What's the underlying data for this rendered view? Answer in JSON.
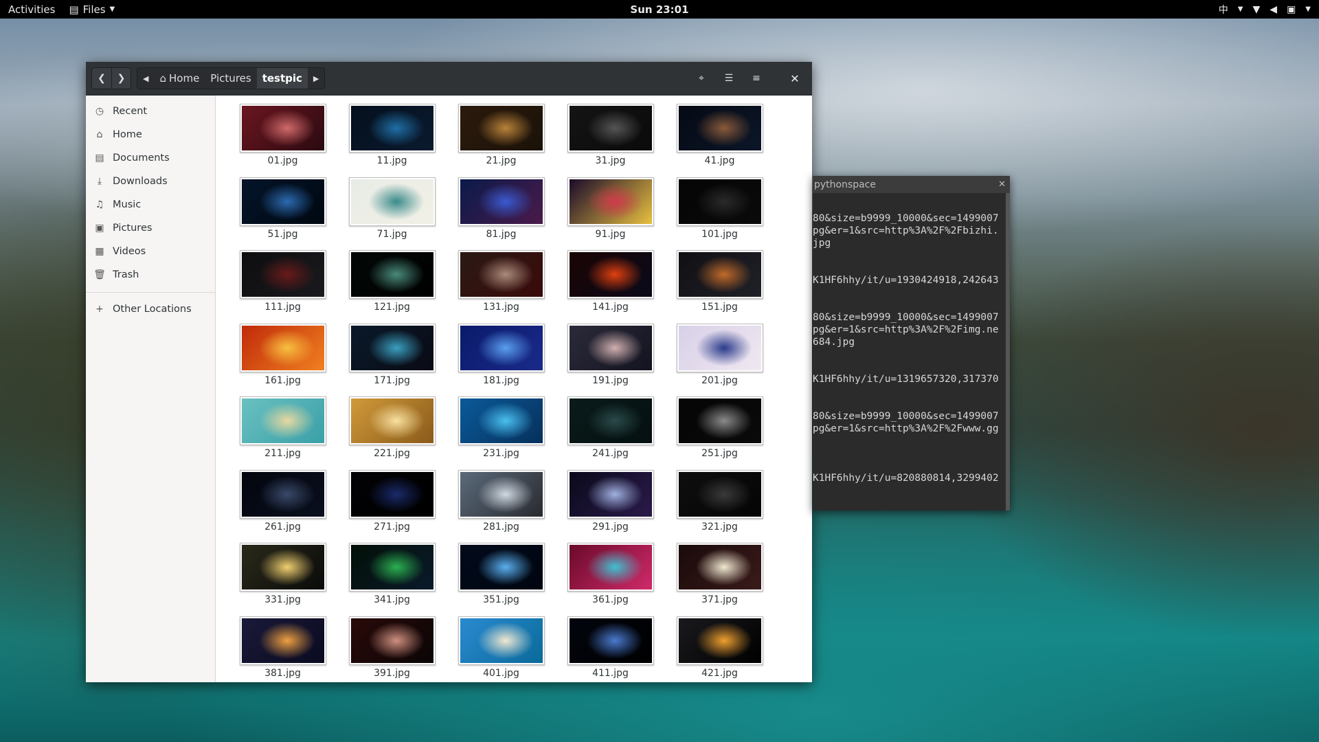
{
  "topbar": {
    "activities": "Activities",
    "app_name": "Files",
    "clock": "Sun 23:01",
    "input_method": "中"
  },
  "files": {
    "path": [
      "Home",
      "Pictures",
      "testpic"
    ],
    "sidebar": [
      {
        "label": "Recent",
        "icon": "clock-icon",
        "glyph": "◷"
      },
      {
        "label": "Home",
        "icon": "home-icon",
        "glyph": "⌂"
      },
      {
        "label": "Documents",
        "icon": "document-icon",
        "glyph": "▤"
      },
      {
        "label": "Downloads",
        "icon": "download-icon",
        "glyph": "⤓"
      },
      {
        "label": "Music",
        "icon": "music-icon",
        "glyph": "♫"
      },
      {
        "label": "Pictures",
        "icon": "picture-icon",
        "glyph": "▣"
      },
      {
        "label": "Videos",
        "icon": "video-icon",
        "glyph": "▦"
      },
      {
        "label": "Trash",
        "icon": "trash-icon",
        "glyph": "🗑"
      }
    ],
    "other_locations": "Other Locations",
    "items": [
      {
        "name": "01.jpg",
        "colors": [
          "#6b1620",
          "#d06a6a",
          "#2a0a10"
        ]
      },
      {
        "name": "11.jpg",
        "colors": [
          "#05101e",
          "#1f6fa6",
          "#0a1a2e"
        ]
      },
      {
        "name": "21.jpg",
        "colors": [
          "#2c1a0c",
          "#b9833a",
          "#1a1208"
        ]
      },
      {
        "name": "31.jpg",
        "colors": [
          "#141414",
          "#555555",
          "#0a0a0a"
        ]
      },
      {
        "name": "41.jpg",
        "colors": [
          "#050a14",
          "#8a5a3a",
          "#0c1628"
        ]
      },
      {
        "name": "51.jpg",
        "colors": [
          "#04142a",
          "#2c6ab0",
          "#000810"
        ]
      },
      {
        "name": "71.jpg",
        "colors": [
          "#e8ece6",
          "#3a8a8a",
          "#f2f0e6"
        ]
      },
      {
        "name": "81.jpg",
        "colors": [
          "#0a1a4a",
          "#3a5ad0",
          "#4a1a4a"
        ]
      },
      {
        "name": "91.jpg",
        "colors": [
          "#1a0a2a",
          "#d03a4a",
          "#e8c040"
        ]
      },
      {
        "name": "101.jpg",
        "colors": [
          "#050505",
          "#2a2a2a",
          "#0a0a0a"
        ]
      },
      {
        "name": "111.jpg",
        "colors": [
          "#0e0e10",
          "#6a1a1a",
          "#1a1a1e"
        ]
      },
      {
        "name": "121.jpg",
        "colors": [
          "#020806",
          "#4a8a7a",
          "#000000"
        ]
      },
      {
        "name": "131.jpg",
        "colors": [
          "#2a1a14",
          "#aa8a7a",
          "#3a0a0a"
        ]
      },
      {
        "name": "141.jpg",
        "colors": [
          "#1a0404",
          "#e04010",
          "#0a0a1a"
        ]
      },
      {
        "name": "151.jpg",
        "colors": [
          "#101014",
          "#c06a2a",
          "#202028"
        ]
      },
      {
        "name": "161.jpg",
        "colors": [
          "#c02a0a",
          "#f8c040",
          "#f08020"
        ]
      },
      {
        "name": "171.jpg",
        "colors": [
          "#0a1a2a",
          "#3aa0c0",
          "#0a0a14"
        ]
      },
      {
        "name": "181.jpg",
        "colors": [
          "#0a1a6a",
          "#5aa0f0",
          "#1a2a8a"
        ]
      },
      {
        "name": "191.jpg",
        "colors": [
          "#2a2a3a",
          "#d0b0b0",
          "#141420"
        ]
      },
      {
        "name": "201.jpg",
        "colors": [
          "#d8d0e8",
          "#2a3a8a",
          "#f0e8f0"
        ]
      },
      {
        "name": "211.jpg",
        "colors": [
          "#6ac0c0",
          "#e8d8a0",
          "#3aa0a8"
        ]
      },
      {
        "name": "221.jpg",
        "colors": [
          "#d09a3a",
          "#f8e0a0",
          "#8a5a1a"
        ]
      },
      {
        "name": "231.jpg",
        "colors": [
          "#0a5a9a",
          "#4ac0f0",
          "#06305a"
        ]
      },
      {
        "name": "241.jpg",
        "colors": [
          "#0a1a1a",
          "#2a4a4a",
          "#051010"
        ]
      },
      {
        "name": "251.jpg",
        "colors": [
          "#050505",
          "#8a8a8a",
          "#0a0a0a"
        ]
      },
      {
        "name": "261.jpg",
        "colors": [
          "#03060e",
          "#3a4a6a",
          "#0a0f1e"
        ]
      },
      {
        "name": "271.jpg",
        "colors": [
          "#020205",
          "#1a2a6a",
          "#000000"
        ]
      },
      {
        "name": "281.jpg",
        "colors": [
          "#5a6a7a",
          "#d0d8e0",
          "#2a2a30"
        ]
      },
      {
        "name": "291.jpg",
        "colors": [
          "#0a0a1a",
          "#a0b0e0",
          "#2a1a4a"
        ]
      },
      {
        "name": "321.jpg",
        "colors": [
          "#0e0e0e",
          "#3a3a3a",
          "#050505"
        ]
      },
      {
        "name": "331.jpg",
        "colors": [
          "#2a2a1a",
          "#f0d070",
          "#0a0a0a"
        ]
      },
      {
        "name": "341.jpg",
        "colors": [
          "#031008",
          "#2ab050",
          "#0a1a2a"
        ]
      },
      {
        "name": "351.jpg",
        "colors": [
          "#020a1a",
          "#5ab0f0",
          "#000510"
        ]
      },
      {
        "name": "361.jpg",
        "colors": [
          "#6a0a2a",
          "#40c0d0",
          "#d02a6a"
        ]
      },
      {
        "name": "371.jpg",
        "colors": [
          "#1a0a0a",
          "#f0e8d0",
          "#3a1a1a"
        ]
      },
      {
        "name": "381.jpg",
        "colors": [
          "#1a1a3a",
          "#f0a040",
          "#0a0a20"
        ]
      },
      {
        "name": "391.jpg",
        "colors": [
          "#2a0a0a",
          "#d09080",
          "#0a0505"
        ]
      },
      {
        "name": "401.jpg",
        "colors": [
          "#2a8ad0",
          "#f0e8d0",
          "#0a6a9a"
        ]
      },
      {
        "name": "411.jpg",
        "colors": [
          "#02050e",
          "#4a7ad0",
          "#000000"
        ]
      },
      {
        "name": "421.jpg",
        "colors": [
          "#1a1a1e",
          "#f0a030",
          "#000000"
        ]
      }
    ]
  },
  "terminal": {
    "title": "pythonspace",
    "lines": [
      "80&size=b9999_10000&sec=1499007",
      "pg&er=1&src=http%3A%2F%2Fbizhi.",
      "jpg",
      "",
      "",
      "K1HF6hhy/it/u=1930424918,242643",
      "",
      "",
      "80&size=b9999_10000&sec=1499007",
      "pg&er=1&src=http%3A%2F%2Fimg.ne",
      "684.jpg",
      "",
      "",
      "K1HF6hhy/it/u=1319657320,317370",
      "",
      "",
      "80&size=b9999_10000&sec=1499007",
      "pg&er=1&src=http%3A%2F%2Fwww.gg",
      "",
      "",
      "",
      "K1HF6hhy/it/u=820880814,3299402"
    ]
  }
}
